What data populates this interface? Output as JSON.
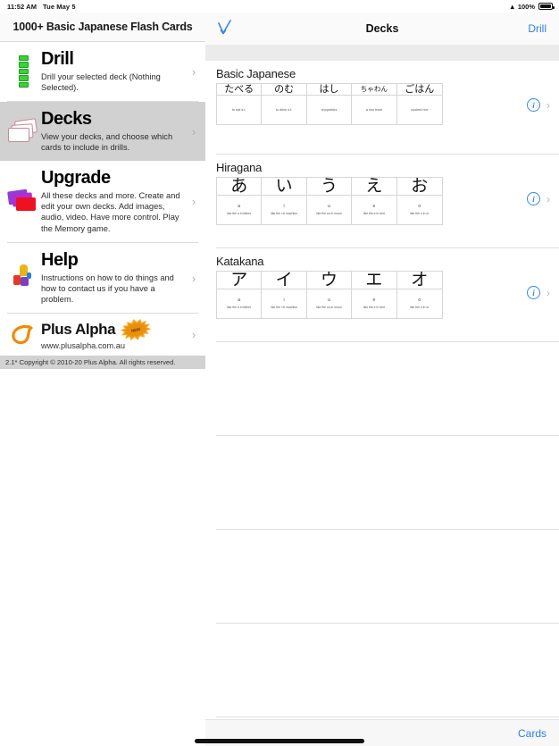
{
  "status_bar": {
    "time": "11:52 AM",
    "date": "Tue May 5",
    "battery_percent": "100%"
  },
  "sidebar": {
    "title": "1000+ Basic Japanese Flash Cards",
    "items": [
      {
        "icon": "drill-cards-icon",
        "title": "Drill",
        "subtitle": "Drill your selected deck (Nothing Selected).",
        "selected": false
      },
      {
        "icon": "decks-stack-icon",
        "title": "Decks",
        "subtitle": "View your decks, and choose which cards to include in drills.",
        "selected": true
      },
      {
        "icon": "upgrade-cards-icon",
        "title": "Upgrade",
        "subtitle": "All these decks and more. Create and edit your own decks. Add images, audio, video. Have more control. Play the Memory game.",
        "selected": false
      },
      {
        "icon": "help-people-icon",
        "title": "Help",
        "subtitle": "Instructions on how to do things and how to contact us if you have a problem.",
        "selected": false
      }
    ],
    "plus_alpha": {
      "name": "Plus Alpha",
      "url": "www.plusalpha.com.au",
      "badge": "NEW"
    },
    "footer": "2.1* Copyright © 2010-20 Plus Alpha. All rights reserved."
  },
  "detail": {
    "nav": {
      "back_icon": "checkmark-down-arrow-icon",
      "title": "Decks",
      "right_button": "Drill"
    },
    "toolbar": {
      "right_button": "Cards"
    },
    "info_icon": "info-circle-icon",
    "chevron_icon": "chevron-right-icon",
    "decks": [
      {
        "name": "Basic Japanese",
        "cards": [
          {
            "front": "たべる",
            "front_size": "normal",
            "back_main": "",
            "back_sub": "to eat s.t."
          },
          {
            "front": "のむ",
            "front_size": "normal",
            "back_main": "",
            "back_sub": "to drink s.t."
          },
          {
            "front": "はし",
            "front_size": "normal",
            "back_main": "",
            "back_sub": "chopsticks"
          },
          {
            "front": "ちゃわん",
            "front_size": "small",
            "back_main": "",
            "back_sub": "a rice bowl"
          },
          {
            "front": "ごはん",
            "front_size": "normal",
            "back_main": "",
            "back_sub": "cooked rice"
          }
        ]
      },
      {
        "name": "Hiragana",
        "cards": [
          {
            "front": "あ",
            "front_size": "kana",
            "back_main": "a",
            "back_sub": "like the a in father"
          },
          {
            "front": "い",
            "front_size": "kana",
            "back_main": "i",
            "back_sub": "like the i in machine"
          },
          {
            "front": "う",
            "front_size": "kana",
            "back_main": "u",
            "back_sub": "like the oo in moon"
          },
          {
            "front": "え",
            "front_size": "kana",
            "back_main": "e",
            "back_sub": "like the e in bed"
          },
          {
            "front": "お",
            "front_size": "kana",
            "back_main": "o",
            "back_sub": "like the o in or"
          }
        ]
      },
      {
        "name": "Katakana",
        "cards": [
          {
            "front": "ア",
            "front_size": "kana",
            "back_main": "a",
            "back_sub": "like the a in father"
          },
          {
            "front": "イ",
            "front_size": "kana",
            "back_main": "i",
            "back_sub": "like the i in machine"
          },
          {
            "front": "ウ",
            "front_size": "kana",
            "back_main": "u",
            "back_sub": "like the oo in moon"
          },
          {
            "front": "エ",
            "front_size": "kana",
            "back_main": "e",
            "back_sub": "like the e in bed"
          },
          {
            "front": "オ",
            "front_size": "kana",
            "back_main": "o",
            "back_sub": "like the o in or"
          }
        ]
      }
    ],
    "empty_rows": 4
  }
}
